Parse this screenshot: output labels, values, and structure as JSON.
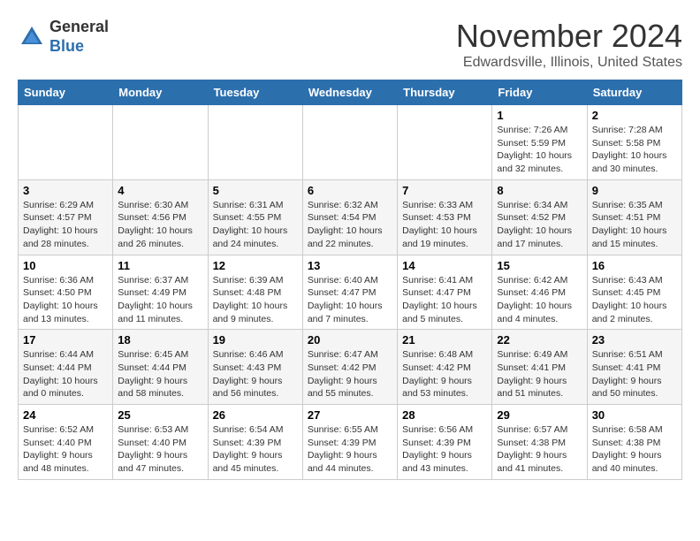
{
  "header": {
    "logo_line1": "General",
    "logo_line2": "Blue",
    "month_title": "November 2024",
    "location": "Edwardsville, Illinois, United States"
  },
  "weekdays": [
    "Sunday",
    "Monday",
    "Tuesday",
    "Wednesday",
    "Thursday",
    "Friday",
    "Saturday"
  ],
  "weeks": [
    [
      {
        "day": "",
        "info": ""
      },
      {
        "day": "",
        "info": ""
      },
      {
        "day": "",
        "info": ""
      },
      {
        "day": "",
        "info": ""
      },
      {
        "day": "",
        "info": ""
      },
      {
        "day": "1",
        "info": "Sunrise: 7:26 AM\nSunset: 5:59 PM\nDaylight: 10 hours\nand 32 minutes."
      },
      {
        "day": "2",
        "info": "Sunrise: 7:28 AM\nSunset: 5:58 PM\nDaylight: 10 hours\nand 30 minutes."
      }
    ],
    [
      {
        "day": "3",
        "info": "Sunrise: 6:29 AM\nSunset: 4:57 PM\nDaylight: 10 hours\nand 28 minutes."
      },
      {
        "day": "4",
        "info": "Sunrise: 6:30 AM\nSunset: 4:56 PM\nDaylight: 10 hours\nand 26 minutes."
      },
      {
        "day": "5",
        "info": "Sunrise: 6:31 AM\nSunset: 4:55 PM\nDaylight: 10 hours\nand 24 minutes."
      },
      {
        "day": "6",
        "info": "Sunrise: 6:32 AM\nSunset: 4:54 PM\nDaylight: 10 hours\nand 22 minutes."
      },
      {
        "day": "7",
        "info": "Sunrise: 6:33 AM\nSunset: 4:53 PM\nDaylight: 10 hours\nand 19 minutes."
      },
      {
        "day": "8",
        "info": "Sunrise: 6:34 AM\nSunset: 4:52 PM\nDaylight: 10 hours\nand 17 minutes."
      },
      {
        "day": "9",
        "info": "Sunrise: 6:35 AM\nSunset: 4:51 PM\nDaylight: 10 hours\nand 15 minutes."
      }
    ],
    [
      {
        "day": "10",
        "info": "Sunrise: 6:36 AM\nSunset: 4:50 PM\nDaylight: 10 hours\nand 13 minutes."
      },
      {
        "day": "11",
        "info": "Sunrise: 6:37 AM\nSunset: 4:49 PM\nDaylight: 10 hours\nand 11 minutes."
      },
      {
        "day": "12",
        "info": "Sunrise: 6:39 AM\nSunset: 4:48 PM\nDaylight: 10 hours\nand 9 minutes."
      },
      {
        "day": "13",
        "info": "Sunrise: 6:40 AM\nSunset: 4:47 PM\nDaylight: 10 hours\nand 7 minutes."
      },
      {
        "day": "14",
        "info": "Sunrise: 6:41 AM\nSunset: 4:47 PM\nDaylight: 10 hours\nand 5 minutes."
      },
      {
        "day": "15",
        "info": "Sunrise: 6:42 AM\nSunset: 4:46 PM\nDaylight: 10 hours\nand 4 minutes."
      },
      {
        "day": "16",
        "info": "Sunrise: 6:43 AM\nSunset: 4:45 PM\nDaylight: 10 hours\nand 2 minutes."
      }
    ],
    [
      {
        "day": "17",
        "info": "Sunrise: 6:44 AM\nSunset: 4:44 PM\nDaylight: 10 hours\nand 0 minutes."
      },
      {
        "day": "18",
        "info": "Sunrise: 6:45 AM\nSunset: 4:44 PM\nDaylight: 9 hours\nand 58 minutes."
      },
      {
        "day": "19",
        "info": "Sunrise: 6:46 AM\nSunset: 4:43 PM\nDaylight: 9 hours\nand 56 minutes."
      },
      {
        "day": "20",
        "info": "Sunrise: 6:47 AM\nSunset: 4:42 PM\nDaylight: 9 hours\nand 55 minutes."
      },
      {
        "day": "21",
        "info": "Sunrise: 6:48 AM\nSunset: 4:42 PM\nDaylight: 9 hours\nand 53 minutes."
      },
      {
        "day": "22",
        "info": "Sunrise: 6:49 AM\nSunset: 4:41 PM\nDaylight: 9 hours\nand 51 minutes."
      },
      {
        "day": "23",
        "info": "Sunrise: 6:51 AM\nSunset: 4:41 PM\nDaylight: 9 hours\nand 50 minutes."
      }
    ],
    [
      {
        "day": "24",
        "info": "Sunrise: 6:52 AM\nSunset: 4:40 PM\nDaylight: 9 hours\nand 48 minutes."
      },
      {
        "day": "25",
        "info": "Sunrise: 6:53 AM\nSunset: 4:40 PM\nDaylight: 9 hours\nand 47 minutes."
      },
      {
        "day": "26",
        "info": "Sunrise: 6:54 AM\nSunset: 4:39 PM\nDaylight: 9 hours\nand 45 minutes."
      },
      {
        "day": "27",
        "info": "Sunrise: 6:55 AM\nSunset: 4:39 PM\nDaylight: 9 hours\nand 44 minutes."
      },
      {
        "day": "28",
        "info": "Sunrise: 6:56 AM\nSunset: 4:39 PM\nDaylight: 9 hours\nand 43 minutes."
      },
      {
        "day": "29",
        "info": "Sunrise: 6:57 AM\nSunset: 4:38 PM\nDaylight: 9 hours\nand 41 minutes."
      },
      {
        "day": "30",
        "info": "Sunrise: 6:58 AM\nSunset: 4:38 PM\nDaylight: 9 hours\nand 40 minutes."
      }
    ]
  ]
}
